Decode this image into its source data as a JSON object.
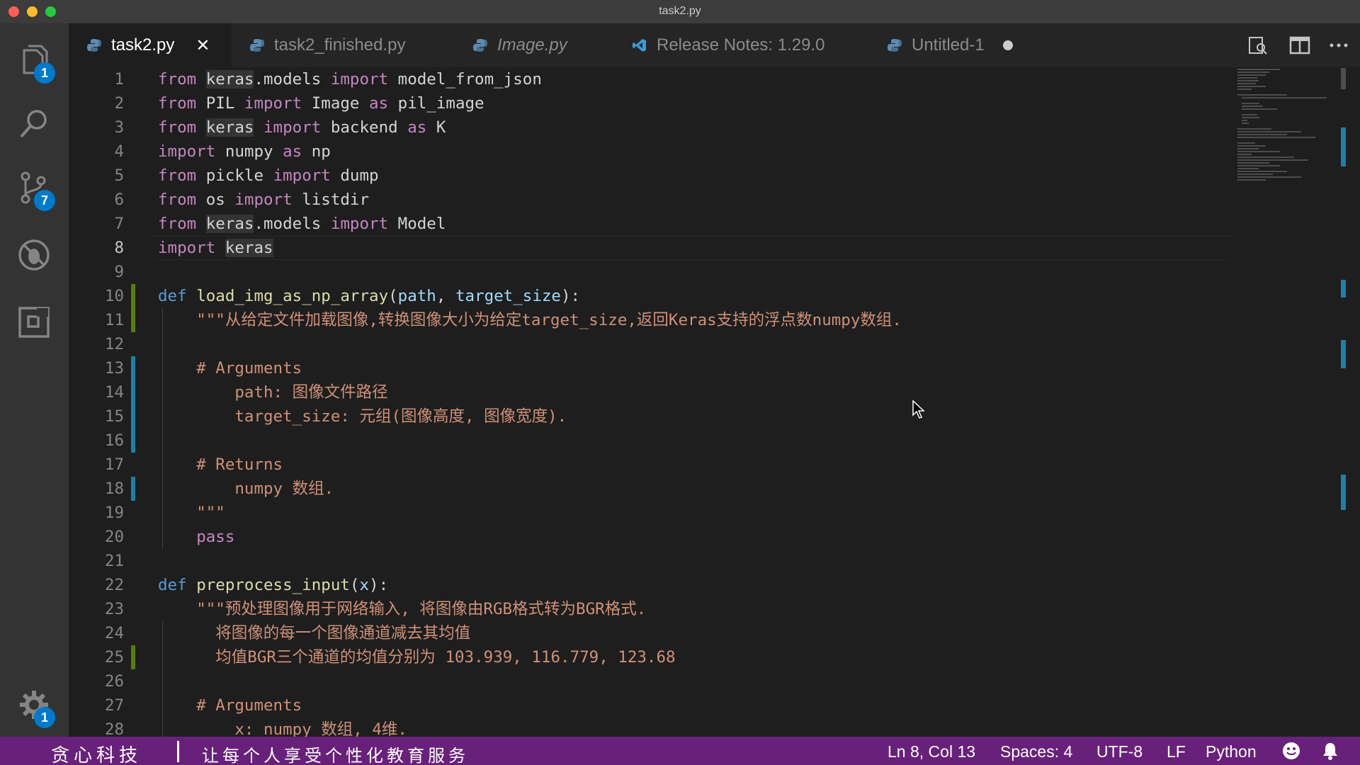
{
  "window": {
    "title": "task2.py"
  },
  "activity_bar": {
    "explorer_badge": "1",
    "scm_badge": "7",
    "settings_badge": "1"
  },
  "tabs": [
    {
      "label": "task2.py",
      "icon": "python-icon",
      "active": true
    },
    {
      "label": "task2_finished.py",
      "icon": "python-icon"
    },
    {
      "label": "Image.py",
      "icon": "python-icon"
    },
    {
      "label": "Release Notes: 1.29.0",
      "icon": "vscode-icon"
    },
    {
      "label": "Untitled-1",
      "icon": "python-icon"
    }
  ],
  "editor": {
    "lines": [
      {
        "n": "1",
        "parts": [
          [
            "kw",
            "from "
          ],
          [
            "hlw",
            "keras"
          ],
          [
            "",
            "."
          ],
          [
            "",
            "models "
          ],
          [
            "kw",
            "import "
          ],
          [
            "",
            "model_from_json"
          ]
        ]
      },
      {
        "n": "2",
        "parts": [
          [
            "kw",
            "from "
          ],
          [
            "",
            "PIL "
          ],
          [
            "kw",
            "import "
          ],
          [
            "",
            "Image "
          ],
          [
            "kw",
            "as "
          ],
          [
            "",
            "pil_image"
          ]
        ]
      },
      {
        "n": "3",
        "parts": [
          [
            "kw",
            "from "
          ],
          [
            "hlw",
            "keras"
          ],
          [
            "kw",
            " import "
          ],
          [
            "",
            "backend "
          ],
          [
            "kw",
            "as "
          ],
          [
            "",
            "K"
          ]
        ]
      },
      {
        "n": "4",
        "parts": [
          [
            "kw",
            "import "
          ],
          [
            "",
            "numpy "
          ],
          [
            "kw",
            "as "
          ],
          [
            "",
            "np"
          ]
        ]
      },
      {
        "n": "5",
        "parts": [
          [
            "kw",
            "from "
          ],
          [
            "",
            "pickle "
          ],
          [
            "kw",
            "import "
          ],
          [
            "",
            "dump"
          ]
        ]
      },
      {
        "n": "6",
        "parts": [
          [
            "kw",
            "from "
          ],
          [
            "",
            "os "
          ],
          [
            "kw",
            "import "
          ],
          [
            "",
            "listdir"
          ]
        ]
      },
      {
        "n": "7",
        "parts": [
          [
            "kw",
            "from "
          ],
          [
            "hlw",
            "keras"
          ],
          [
            "",
            "."
          ],
          [
            "",
            "models "
          ],
          [
            "kw",
            "import "
          ],
          [
            "",
            "Model"
          ]
        ]
      },
      {
        "n": "8",
        "parts": [
          [
            "kw",
            "import "
          ],
          [
            "hlw",
            "keras"
          ]
        ]
      },
      {
        "n": "9",
        "parts": []
      },
      {
        "n": "10",
        "parts": [
          [
            "def",
            "def "
          ],
          [
            "fn",
            "load_img_as_np_array"
          ],
          [
            "",
            "("
          ],
          [
            "par",
            "path"
          ],
          [
            "",
            ", "
          ],
          [
            "par",
            "target_size"
          ],
          [
            "",
            "):"
          ]
        ]
      },
      {
        "n": "11",
        "parts": [
          [
            "",
            "    "
          ],
          [
            "str",
            "\"\"\"从给定文件加载图像,转换图像大小为给定target_size,返回Keras支持的浮点数numpy数组."
          ]
        ]
      },
      {
        "n": "12",
        "parts": []
      },
      {
        "n": "13",
        "parts": [
          [
            "",
            "    "
          ],
          [
            "str",
            "# Arguments"
          ]
        ]
      },
      {
        "n": "14",
        "parts": [
          [
            "",
            "        "
          ],
          [
            "str",
            "path: 图像文件路径"
          ]
        ]
      },
      {
        "n": "15",
        "parts": [
          [
            "",
            "        "
          ],
          [
            "str",
            "target_size: 元组(图像高度, 图像宽度)."
          ]
        ]
      },
      {
        "n": "16",
        "parts": []
      },
      {
        "n": "17",
        "parts": [
          [
            "",
            "    "
          ],
          [
            "str",
            "# Returns"
          ]
        ]
      },
      {
        "n": "18",
        "parts": [
          [
            "",
            "        "
          ],
          [
            "str",
            "numpy 数组."
          ]
        ]
      },
      {
        "n": "19",
        "parts": [
          [
            "",
            "    "
          ],
          [
            "str",
            "\"\"\""
          ]
        ]
      },
      {
        "n": "20",
        "parts": [
          [
            "",
            "    "
          ],
          [
            "kw",
            "pass"
          ]
        ]
      },
      {
        "n": "21",
        "parts": []
      },
      {
        "n": "22",
        "parts": [
          [
            "def",
            "def "
          ],
          [
            "fn",
            "preprocess_input"
          ],
          [
            "",
            "("
          ],
          [
            "par",
            "x"
          ],
          [
            "",
            "):"
          ]
        ]
      },
      {
        "n": "23",
        "parts": [
          [
            "",
            "    "
          ],
          [
            "str",
            "\"\"\"预处理图像用于网络输入, 将图像由RGB格式转为BGR格式."
          ]
        ]
      },
      {
        "n": "24",
        "parts": [
          [
            "",
            "      "
          ],
          [
            "str",
            "将图像的每一个图像通道减去其均值"
          ]
        ]
      },
      {
        "n": "25",
        "parts": [
          [
            "",
            "      "
          ],
          [
            "str",
            "均值BGR三个通道的均值分别为 103.939, 116.779, 123.68"
          ]
        ]
      },
      {
        "n": "26",
        "parts": []
      },
      {
        "n": "27",
        "parts": [
          [
            "",
            "    "
          ],
          [
            "str",
            "# Arguments"
          ]
        ]
      },
      {
        "n": "28",
        "parts": [
          [
            "",
            "        "
          ],
          [
            "str",
            "x: numpy 数组, 4维."
          ]
        ]
      }
    ]
  },
  "status": {
    "brand": "贪心科技",
    "slogan": "让每个人享受个性化教育服务",
    "position": "Ln 8, Col 13",
    "spaces": "Spaces: 4",
    "encoding": "UTF-8",
    "eol": "LF",
    "language": "Python"
  },
  "colors": {
    "statusbar": "#68217a",
    "keyword": "#c586c0",
    "function": "#dcdcaa",
    "string": "#ce9178",
    "badge": "#007acc"
  }
}
